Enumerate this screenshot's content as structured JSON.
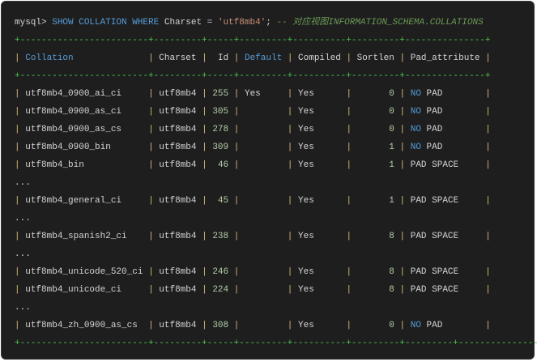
{
  "command": {
    "prompt": "mysql> ",
    "keywords1": "SHOW COLLATION WHERE",
    "ident": " Charset = ",
    "string": "'utf8mb4'",
    "semicolon": ";",
    "comment": " -- 对应视图INFORMATION_SCHEMA.COLLATIONS"
  },
  "separator": "+------------------------+---------+-----+---------+----------+---------+---------------+",
  "bottom_separator": "+------------------------+---------+-----+---------+----------+---------+---------+---------------+",
  "ellipsis": "...",
  "columns": [
    "Collation",
    "Charset",
    "Id",
    "Default",
    "Compiled",
    "Sortlen",
    "Pad_attribute"
  ],
  "rows": [
    [
      "utf8mb4_0900_ai_ci",
      "utf8mb4",
      "255",
      "Yes",
      "Yes",
      "0",
      "NO PAD"
    ],
    [
      "utf8mb4_0900_as_ci",
      "utf8mb4",
      "305",
      "",
      "Yes",
      "0",
      "NO PAD"
    ],
    [
      "utf8mb4_0900_as_cs",
      "utf8mb4",
      "278",
      "",
      "Yes",
      "0",
      "NO PAD"
    ],
    [
      "utf8mb4_0900_bin",
      "utf8mb4",
      "309",
      "",
      "Yes",
      "1",
      "NO PAD"
    ],
    [
      "utf8mb4_bin",
      "utf8mb4",
      "46",
      "",
      "Yes",
      "1",
      "PAD SPACE"
    ],
    "...",
    [
      "utf8mb4_general_ci",
      "utf8mb4",
      "45",
      "",
      "Yes",
      "1",
      "PAD SPACE"
    ],
    "...",
    [
      "utf8mb4_spanish2_ci",
      "utf8mb4",
      "238",
      "",
      "Yes",
      "8",
      "PAD SPACE"
    ],
    "...",
    [
      "utf8mb4_unicode_520_ci",
      "utf8mb4",
      "246",
      "",
      "Yes",
      "8",
      "PAD SPACE"
    ],
    [
      "utf8mb4_unicode_ci",
      "utf8mb4",
      "224",
      "",
      "Yes",
      "8",
      "PAD SPACE"
    ],
    "...",
    [
      "utf8mb4_zh_0900_as_cs",
      "utf8mb4",
      "308",
      "",
      "Yes",
      "0",
      "NO PAD"
    ]
  ],
  "colors": {
    "background": "#1e1e1e",
    "keyword": "#569cd6",
    "string": "#ce9178",
    "comment": "#6a9955",
    "pipe": "#d7ba7d",
    "separator": "#4ec94e",
    "number": "#b5cea8"
  }
}
